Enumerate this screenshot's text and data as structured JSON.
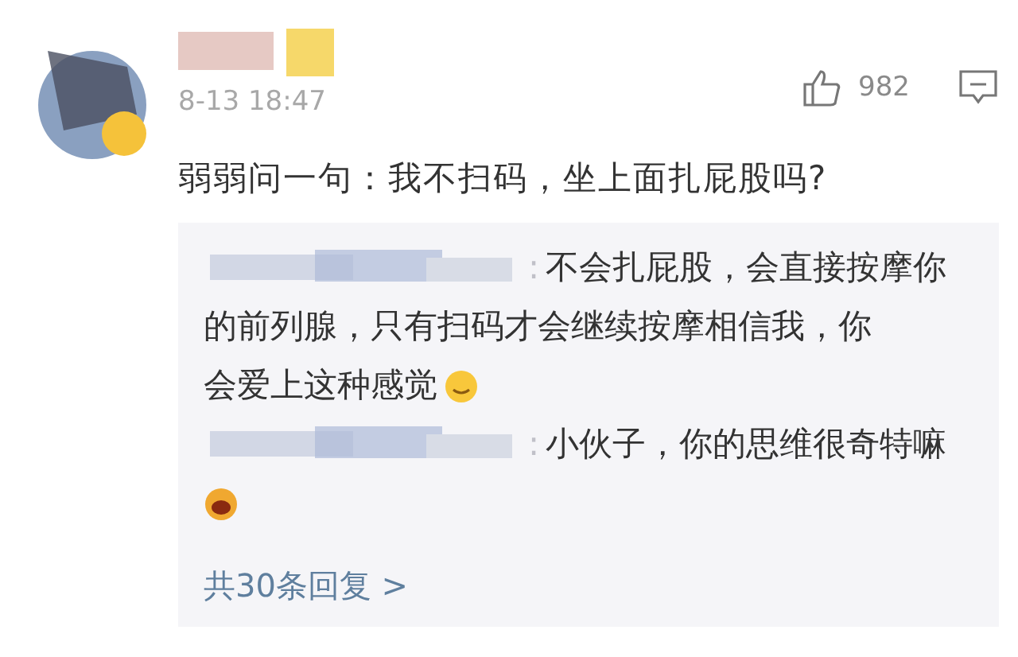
{
  "comment": {
    "timestamp": "8-13 18:47",
    "likes": "982",
    "text": "弱弱问一句：我不扫码，坐上面扎屁股吗?"
  },
  "replies": [
    {
      "separator": ":",
      "lines": [
        "不会扎屁股，会直接按摩你",
        "的前列腺，只有扫码才会继续按摩相信我，你",
        "会爱上这种感觉"
      ],
      "emoji": {
        "kind": "smile"
      }
    },
    {
      "separator": ":",
      "lines": [
        "小伙子，你的思维很奇特嘛"
      ],
      "emoji": {
        "kind": "laugh"
      }
    }
  ],
  "more_replies": "共30条回复 >"
}
